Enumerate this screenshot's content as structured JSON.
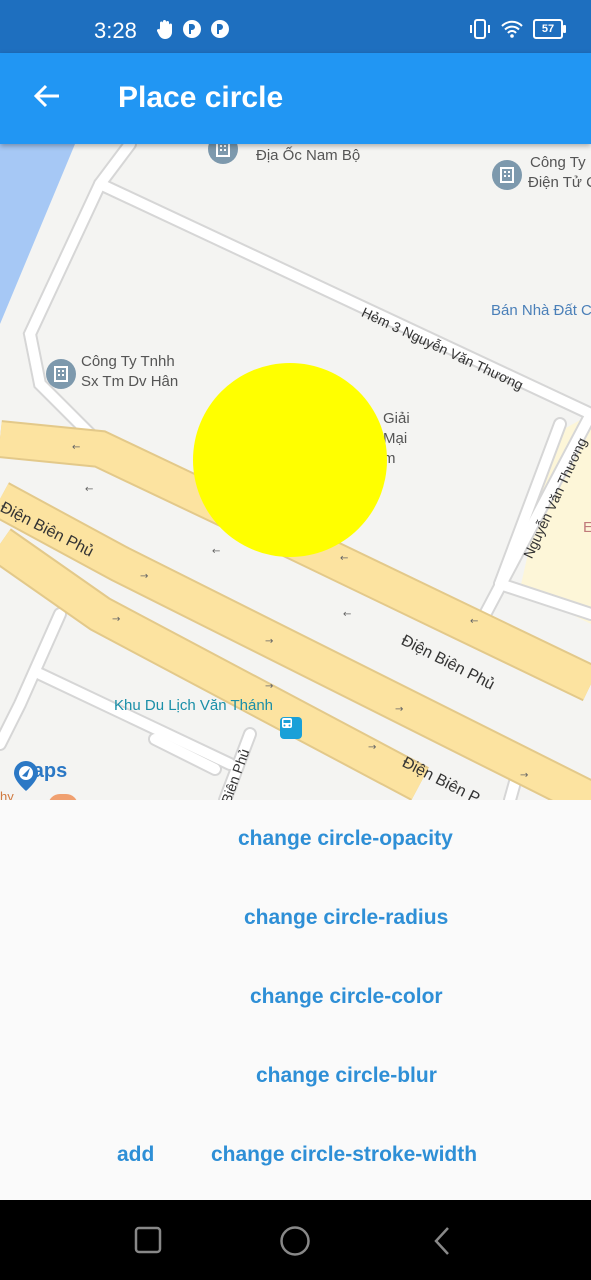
{
  "status_bar": {
    "time": "3:28",
    "battery": "57"
  },
  "app_bar": {
    "title": "Place circle"
  },
  "map": {
    "labels": {
      "dia_oc": "Địa Ốc Nam Bộ",
      "cong_ty_1": "Công Ty",
      "cong_ty_2": "Điện Tử C",
      "ban_nha": "Bán Nhà Đất C",
      "hem3": "Hẻm 3 Nguyễn Văn Thương",
      "tnhh1": "Công Ty Tnhh",
      "tnhh2": "Sx Tm Dv Hân",
      "giai1": "Giải",
      "giai2": "Mại",
      "giai3": "m",
      "nguyen_van_thuong": "Nguyễn Văn Thương",
      "dien_bien_phu_1": "Điện Biên Phủ",
      "dien_bien_phu_2": "Điện Biên Phủ",
      "dien_bien_phu_3": "Điện Biên P",
      "dien_bien_phu_4": "Biên Phủ",
      "khu_du_lich": "Khu Du Lịch Văn Thánh",
      "hy": "hy",
      "e": "E"
    },
    "logo": "maps",
    "circle_color": "#ffff00"
  },
  "controls": {
    "opacity": "change circle-opacity",
    "radius": "change circle-radius",
    "color": "change circle-color",
    "blur": "change circle-blur",
    "add": "add",
    "stroke_width": "change circle-stroke-width"
  },
  "colors": {
    "app_bar": "#2196f3",
    "status_bar": "#1e6fbf",
    "accent": "#2e8fd6",
    "road_major": "#fce3a0"
  }
}
